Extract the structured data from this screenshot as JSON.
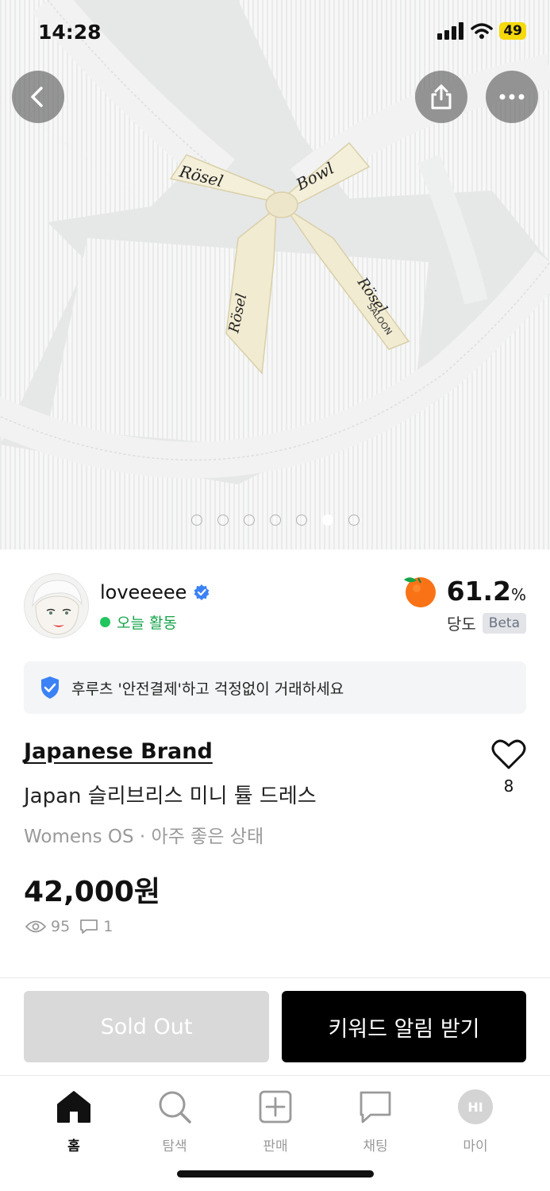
{
  "status_bar": {
    "time": "14:28",
    "battery": "49"
  },
  "photo": {
    "description_icon": "product-photo",
    "pages": 7,
    "active_page": 6,
    "ribbon_text": "Rösel Bowl",
    "ribbon_sub": "SALOON"
  },
  "seller": {
    "name": "loveeeee",
    "activity": "오늘 활동",
    "score": "61.2",
    "score_unit": "%",
    "score_label": "당도",
    "beta": "Beta"
  },
  "safe_payment": {
    "text": "후루츠 '안전결제'하고 걱정없이 거래하세요"
  },
  "product": {
    "brand": "Japanese Brand",
    "title": "Japan 슬리브리스 미니 튤 드레스",
    "meta": "Womens OS · 아주 좋은 상태",
    "price": "42,000원",
    "likes": "8",
    "views": "95",
    "comments": "1"
  },
  "actions": {
    "sold_out": "Sold Out",
    "keyword_alert": "키워드 알림 받기"
  },
  "nav": {
    "items": [
      {
        "label": "홈",
        "icon": "home-icon"
      },
      {
        "label": "탐색",
        "icon": "search-icon"
      },
      {
        "label": "판매",
        "icon": "plus-square-icon"
      },
      {
        "label": "채팅",
        "icon": "chat-bubble-icon"
      },
      {
        "label": "마이",
        "icon": "profile-icon",
        "avatar_text": "HI"
      }
    ]
  },
  "colors": {
    "accent_green": "#22c55e",
    "verified_blue": "#3b82f6",
    "primary_black": "#000000",
    "disabled_gray": "#d9d9d9"
  }
}
